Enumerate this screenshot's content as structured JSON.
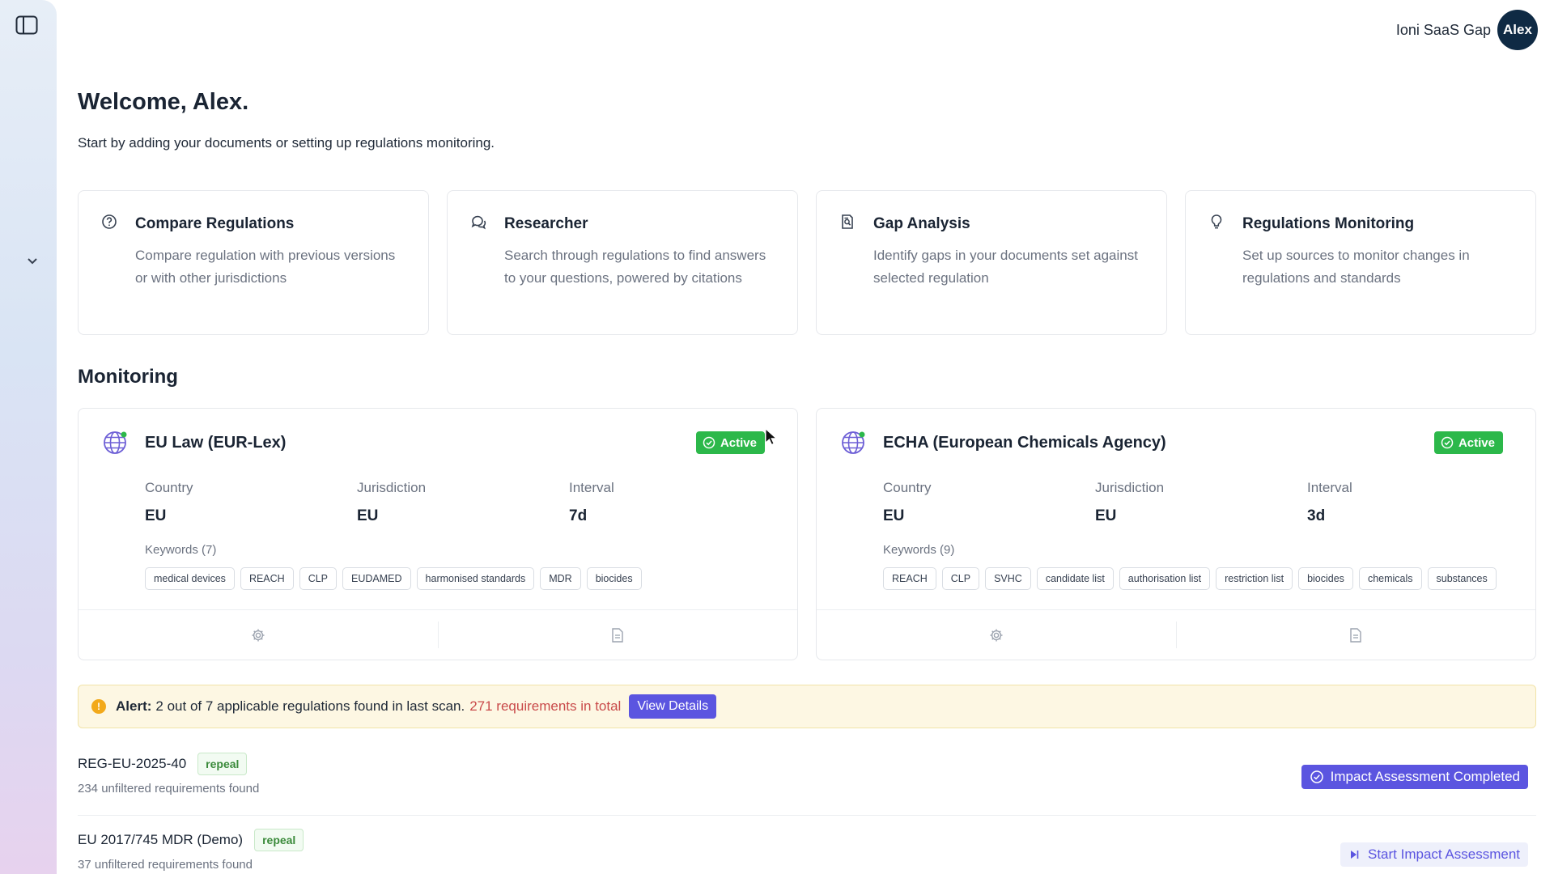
{
  "header": {
    "org_name": "Ioni SaaS Gap",
    "avatar_initials": "Alex"
  },
  "welcome": {
    "title": "Welcome, Alex.",
    "subtitle": "Start by adding your documents or setting up regulations monitoring."
  },
  "features": [
    {
      "title": "Compare Regulations",
      "desc": "Compare regulation with previous versions or with other jurisdictions",
      "icon": "question-circle-icon"
    },
    {
      "title": "Researcher",
      "desc": "Search through regulations to find answers to your questions, powered by citations",
      "icon": "chat-bubble-icon"
    },
    {
      "title": "Gap Analysis",
      "desc": "Identify gaps in your documents set against selected regulation",
      "icon": "document-search-icon"
    },
    {
      "title": "Regulations Monitoring",
      "desc": "Set up sources to monitor changes in regulations and standards",
      "icon": "lightbulb-icon"
    }
  ],
  "monitoring": {
    "section_title": "Monitoring",
    "sources": [
      {
        "title": "EU Law (EUR-Lex)",
        "status": "Active",
        "country_label": "Country",
        "country": "EU",
        "jurisdiction_label": "Jurisdiction",
        "jurisdiction": "EU",
        "interval_label": "Interval",
        "interval": "7d",
        "keywords_label": "Keywords (7)",
        "keywords": [
          "medical devices",
          "REACH",
          "CLP",
          "EUDAMED",
          "harmonised standards",
          "MDR",
          "biocides"
        ]
      },
      {
        "title": "ECHA (European Chemicals Agency)",
        "status": "Active",
        "country_label": "Country",
        "country": "EU",
        "jurisdiction_label": "Jurisdiction",
        "jurisdiction": "EU",
        "interval_label": "Interval",
        "interval": "3d",
        "keywords_label": "Keywords (9)",
        "keywords": [
          "REACH",
          "CLP",
          "SVHC",
          "candidate list",
          "authorisation list",
          "restriction list",
          "biocides",
          "chemicals",
          "substances"
        ]
      }
    ]
  },
  "alert": {
    "label": "Alert:",
    "message": "2 out of 7 applicable regulations found in last scan.",
    "highlight": "271 requirements in total",
    "button": "View Details"
  },
  "regulations": [
    {
      "name": "REG-EU-2025-40",
      "tag": "repeal",
      "sub": "234 unfiltered requirements found",
      "action": "Impact Assessment Completed"
    },
    {
      "name": "EU 2017/745 MDR (Demo)",
      "tag": "repeal",
      "sub": "37 unfiltered requirements found",
      "action": "Start Impact Assessment"
    }
  ],
  "colors": {
    "accent": "#5b55e0",
    "active": "#2cb84a",
    "alert_bg": "#fdf7e3",
    "alert_red": "#c94a4a",
    "avatar": "#0f2a44"
  }
}
